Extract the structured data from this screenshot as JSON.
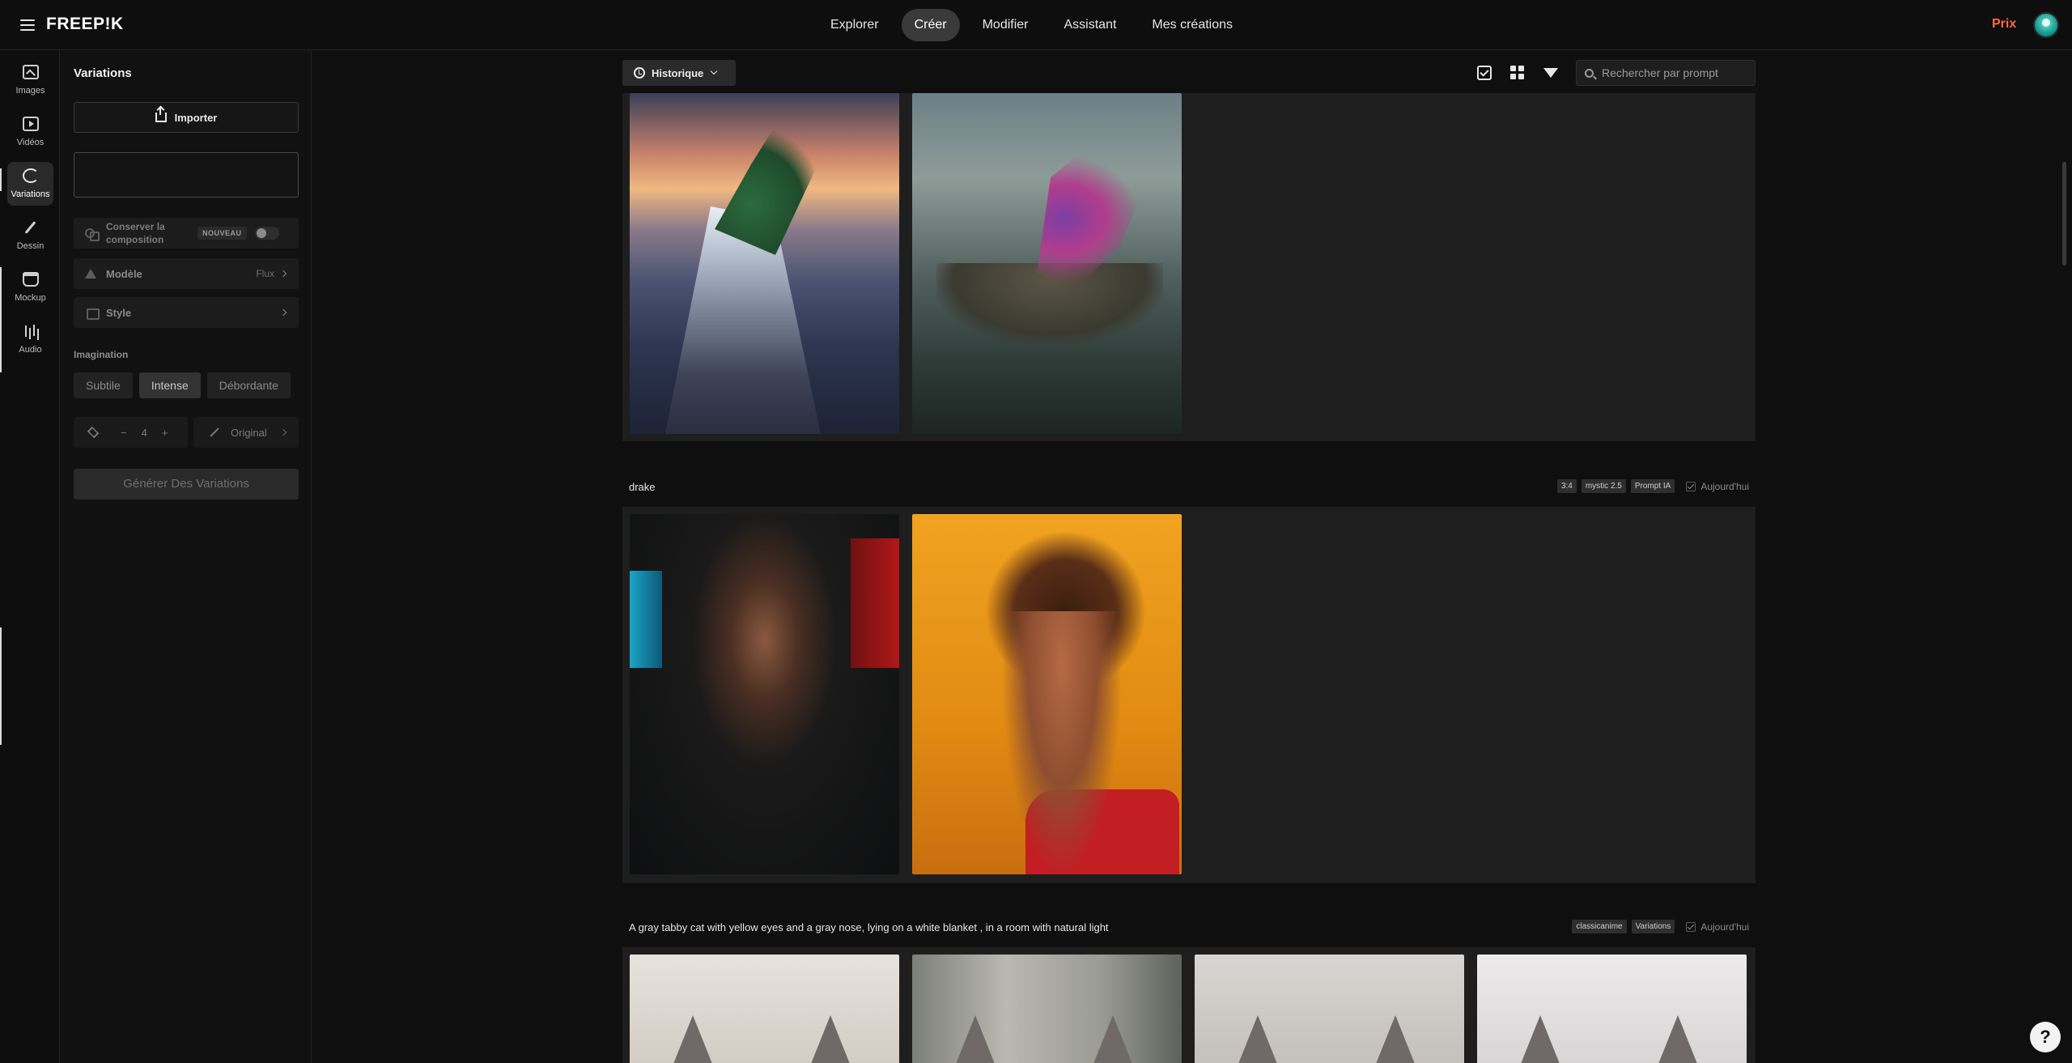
{
  "header": {
    "logo": "FREEP!K",
    "nav": [
      "Explorer",
      "Créer",
      "Modifier",
      "Assistant",
      "Mes créations"
    ],
    "active_nav": "Créer",
    "pricing": "Prix"
  },
  "rail": {
    "items": [
      "Images",
      "Vidéos",
      "Variations",
      "Dessin",
      "Mockup",
      "Audio"
    ],
    "active": "Variations"
  },
  "panel": {
    "title": "Variations",
    "import_label": "Importer",
    "composition_label": "Conserver la composition",
    "new_badge": "NOUVEAU",
    "model_label": "Modèle",
    "model_value": "Flux",
    "style_label": "Style",
    "imagination_title": "Imagination",
    "imagination_options": [
      "Subtile",
      "Intense",
      "Débordante"
    ],
    "imagination_selected": "Intense",
    "count_minus": "−",
    "count_value": "4",
    "count_plus": "+",
    "ratio_label": "Original",
    "generate_label": "Générer Des Variations"
  },
  "toolbar": {
    "history_label": "Historique",
    "search_placeholder": "Rechercher par prompt"
  },
  "groups": [
    {
      "prompt": "drake",
      "tags": [
        "3:4",
        "mystic 2.5",
        "Prompt IA"
      ],
      "date": "Aujourd'hui"
    },
    {
      "prompt": "A gray tabby cat with yellow eyes and a gray nose, lying on a white blanket , in a room with natural light",
      "tags": [
        "classicanime",
        "Variations"
      ],
      "date": "Aujourd'hui"
    }
  ],
  "help": "?"
}
